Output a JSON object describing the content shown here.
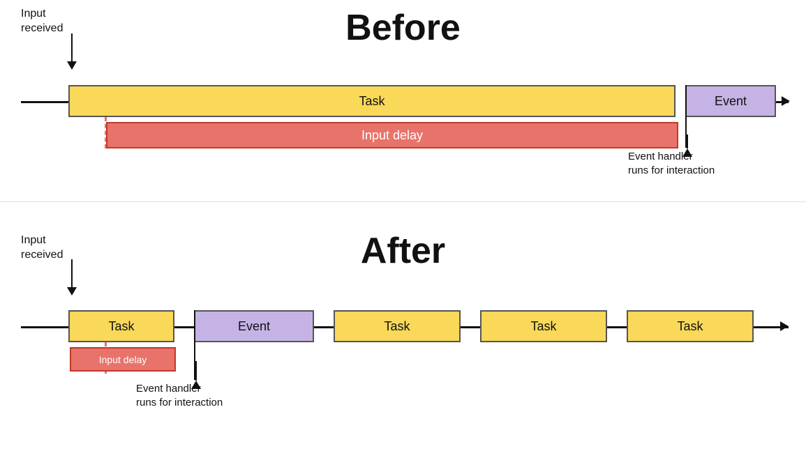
{
  "before": {
    "title": "Before",
    "input_received_label": "Input\nreceived",
    "task_label": "Task",
    "event_label": "Event",
    "input_delay_label": "Input delay",
    "event_handler_label": "Event handler\nruns for interaction"
  },
  "after": {
    "title": "After",
    "input_received_label": "Input\nreceived",
    "task_label_1": "Task",
    "event_label": "Event",
    "task_label_2": "Task",
    "task_label_3": "Task",
    "task_label_4": "Task",
    "input_delay_label": "Input delay",
    "event_handler_label": "Event handler\nruns for interaction"
  }
}
